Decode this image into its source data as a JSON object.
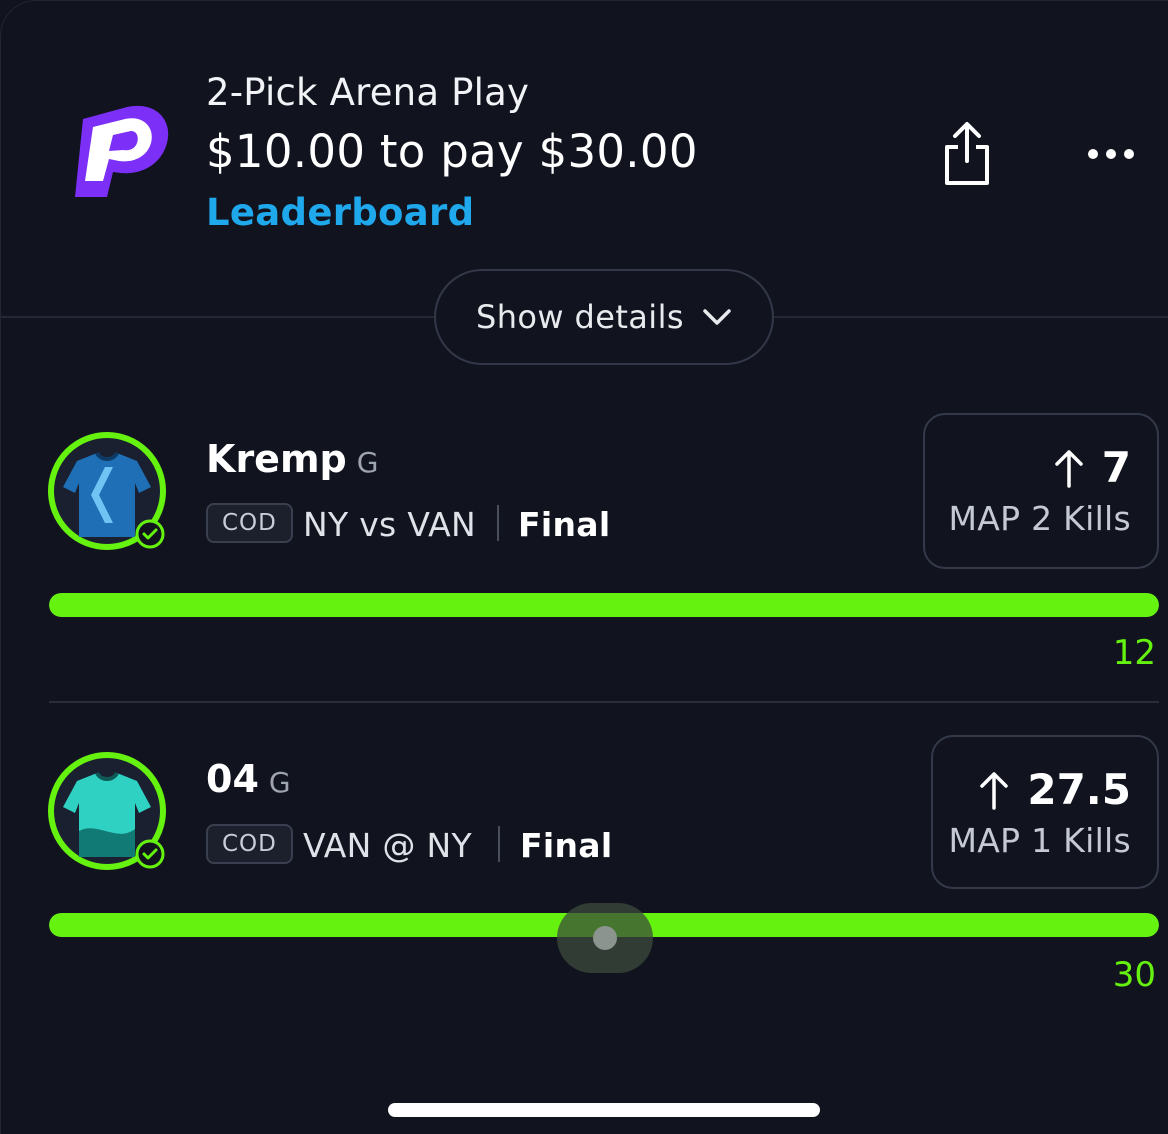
{
  "header": {
    "title": "2-Pick Arena Play",
    "price": "$10.00 to pay $30.00",
    "leaderboard_link": "Leaderboard",
    "details_button": "Show details",
    "brand_color": "#7b2ff7",
    "link_color": "#1fa8ec"
  },
  "picks": [
    {
      "player": "Kremp",
      "position": "G",
      "league": "COD",
      "matchup": "NY vs VAN",
      "status": "Final",
      "direction": "up-arrow-icon",
      "line": "7",
      "stat": "MAP 2 Kills",
      "actual": "12",
      "progress_fraction": 1.0,
      "jersey_color": "#1e6fb5"
    },
    {
      "player": "04",
      "position": "G",
      "league": "COD",
      "matchup": "VAN @ NY",
      "status": "Final",
      "direction": "up-arrow-icon",
      "line": "27.5",
      "stat": "MAP 1 Kills",
      "actual": "30",
      "progress_fraction": 1.0,
      "jersey_color": "#2fd1c2"
    }
  ],
  "colors": {
    "success_green": "#66f20f",
    "background": "#11141f"
  }
}
